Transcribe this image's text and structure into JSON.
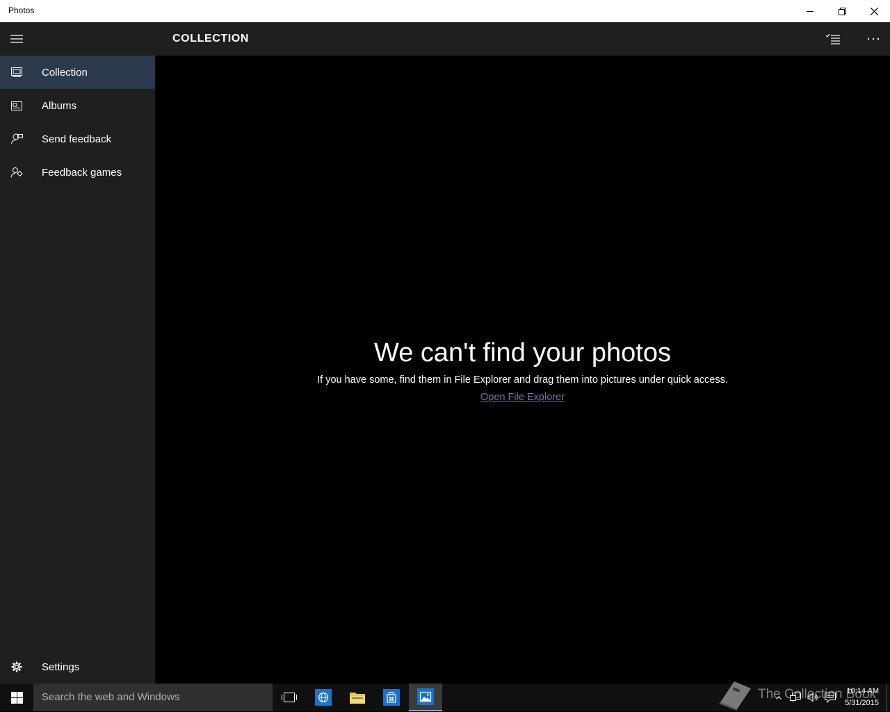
{
  "window": {
    "title": "Photos"
  },
  "sidebar": {
    "items": [
      {
        "label": "Collection",
        "icon": "collection-icon",
        "active": true
      },
      {
        "label": "Albums",
        "icon": "albums-icon",
        "active": false
      },
      {
        "label": "Send feedback",
        "icon": "send-feedback-icon",
        "active": false
      },
      {
        "label": "Feedback games",
        "icon": "feedback-games-icon",
        "active": false
      }
    ],
    "settings_label": "Settings"
  },
  "header": {
    "title": "COLLECTION"
  },
  "empty_state": {
    "heading": "We can't find your photos",
    "message": "If you have some, find them in File Explorer and drag them into pictures under quick access.",
    "link": "Open File Explorer"
  },
  "taskbar": {
    "search_placeholder": "Search the web and Windows",
    "time": "10:14 AM",
    "date": "5/31/2015",
    "watermark": "The Collection Book"
  },
  "colors": {
    "sidebar_bg": "#1f1f1f",
    "active_item_bg": "#2b3a4c",
    "link": "#5e7fa7",
    "content_bg": "#000000"
  }
}
